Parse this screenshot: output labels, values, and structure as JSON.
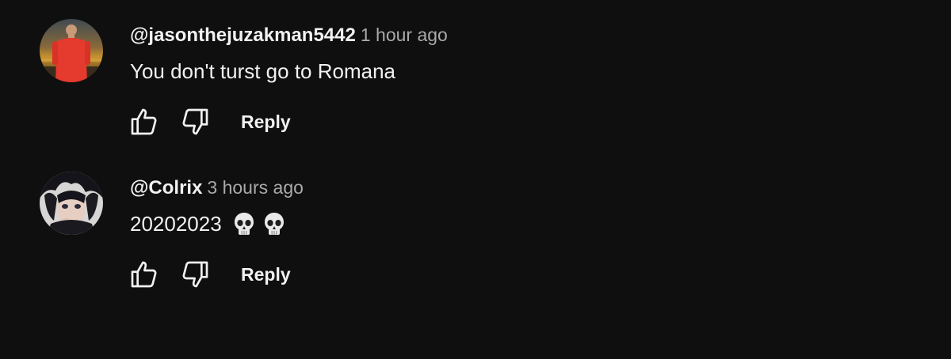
{
  "comments": [
    {
      "author": "@jasonthejuzakman5442",
      "time": "1 hour ago",
      "text": "You don't turst go to Romana",
      "emojis": [],
      "reply_label": "Reply",
      "avatar_icon": "avatar-person-red-shirt"
    },
    {
      "author": "@Colrix",
      "time": "3 hours ago",
      "text": "20202023",
      "emojis": [
        "skull-emoji",
        "skull-emoji"
      ],
      "reply_label": "Reply",
      "avatar_icon": "avatar-anime-character"
    }
  ],
  "colors": {
    "background": "#0f0f0f",
    "text_primary": "#f1f1f1",
    "text_secondary": "#aaaaaa"
  }
}
